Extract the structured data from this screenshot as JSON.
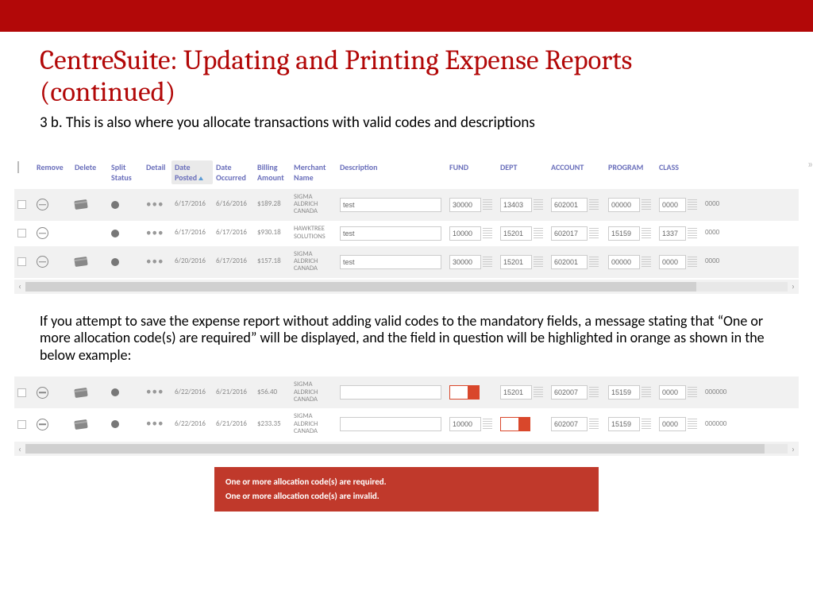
{
  "title": "CentreSuite: Updating and Printing Expense Reports (continued)",
  "subtitle": "3 b. This is also where you allocate transactions with valid codes and descriptions",
  "headers": {
    "remove": "Remove",
    "delete": "Delete",
    "split": "Split Status",
    "detail": "Detail",
    "date_posted": "Date Posted",
    "date_occurred": "Date Occurred",
    "billing": "Billing Amount",
    "merchant": "Merchant Name",
    "desc": "Description",
    "fund": "FUND",
    "dept": "DEPT",
    "account": "ACCOUNT",
    "program": "PROGRAM",
    "class": "CLASS"
  },
  "rows1": [
    {
      "posted": "6/17/2016",
      "occurred": "6/16/2016",
      "amt": "$189.28",
      "merch": "SIGMA ALDRICH CANADA",
      "desc": "test",
      "fund": "30000",
      "dept": "13403",
      "acct": "602001",
      "prog": "00000",
      "class": "0000",
      "over": "0000"
    },
    {
      "posted": "6/17/2016",
      "occurred": "6/17/2016",
      "amt": "$930.18",
      "merch": "HAWKTREE SOLUTIONS",
      "desc": "test",
      "fund": "10000",
      "dept": "15201",
      "acct": "602017",
      "prog": "15159",
      "class": "1337",
      "over": "0000"
    },
    {
      "posted": "6/20/2016",
      "occurred": "6/17/2016",
      "amt": "$157.18",
      "merch": "SIGMA ALDRICH CANADA",
      "desc": "test",
      "fund": "30000",
      "dept": "15201",
      "acct": "602001",
      "prog": "00000",
      "class": "0000",
      "over": "0000"
    }
  ],
  "body2": "If you attempt to save the expense report without adding valid codes to the mandatory fields, a message stating that “One or more allocation code(s) are required”  will be displayed, and the field in question will be highlighted in orange as shown in the below example:",
  "rows2": [
    {
      "posted": "6/22/2016",
      "occurred": "6/21/2016",
      "amt": "$56.40",
      "merch": "SIGMA ALDRICH CANADA",
      "desc": "",
      "fund": "",
      "fund_err": true,
      "dept": "15201",
      "acct": "602007",
      "prog": "15159",
      "class": "0000",
      "over": "000000"
    },
    {
      "posted": "6/22/2016",
      "occurred": "6/21/2016",
      "amt": "$233.35",
      "merch": "SIGMA ALDRICH CANADA",
      "desc": "",
      "fund": "10000",
      "dept": "",
      "dept_err": true,
      "acct": "602007",
      "prog": "15159",
      "class": "0000",
      "over": "000000"
    }
  ],
  "error": {
    "line1": "One or more allocation code(s) are required.",
    "line2": "One or more allocation code(s) are invalid."
  }
}
